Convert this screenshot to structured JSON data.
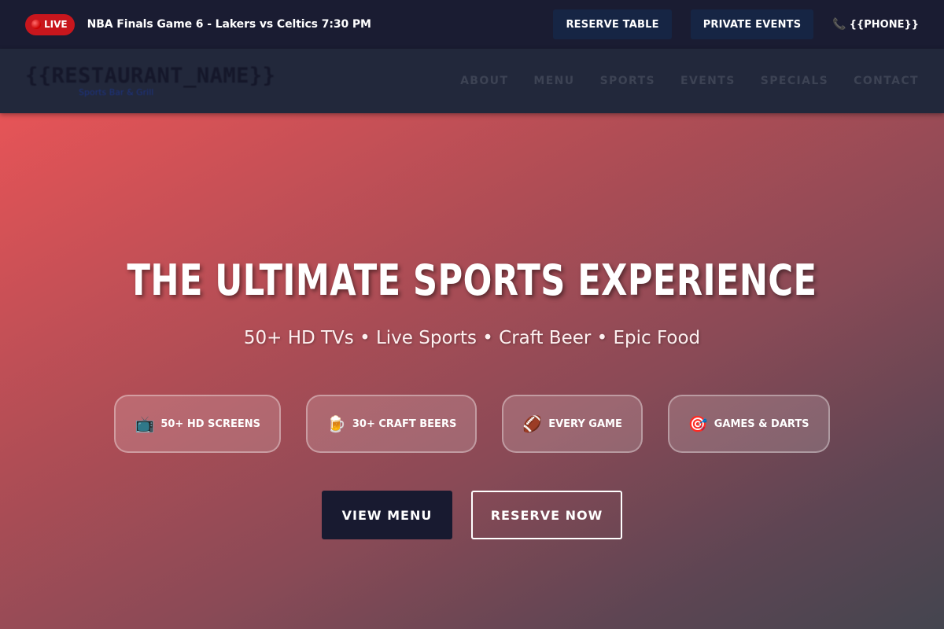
{
  "topbar": {
    "live_label": "LIVE",
    "ticker": "NBA Finals Game 6 - Lakers vs Celtics 7:30 PM",
    "reserve_table": "RESERVE TABLE",
    "private_events": "PRIVATE EVENTS",
    "phone_icon": "phone-icon",
    "phone": "{{PHONE}}"
  },
  "nav": {
    "logo_name": "{{RESTAURANT_NAME}}",
    "logo_tagline": "Sports Bar & Grill",
    "links": [
      "ABOUT",
      "MENU",
      "SPORTS",
      "EVENTS",
      "SPECIALS",
      "CONTACT"
    ]
  },
  "hero": {
    "title": "THE ULTIMATE SPORTS EXPERIENCE",
    "subtitle": "50+ HD TVs • Live Sports • Craft Beer • Epic Food",
    "features": [
      {
        "icon": "📺",
        "icon_name": "tv-icon",
        "label": "50+ HD SCREENS"
      },
      {
        "icon": "🍺",
        "icon_name": "beer-icon",
        "label": "30+ CRAFT BEERS"
      },
      {
        "icon": "🏈",
        "icon_name": "football-icon",
        "label": "EVERY GAME"
      },
      {
        "icon": "🎯",
        "icon_name": "dart-icon",
        "label": "GAMES & DARTS"
      }
    ],
    "cta_primary": "VIEW MENU",
    "cta_secondary": "RESERVE NOW"
  },
  "colors": {
    "topbar_bg": "#1a1c32",
    "live_red": "#c8161d",
    "button_navy": "#162544",
    "hero_gradient_start": "#e65457",
    "hero_gradient_end": "#44454f",
    "primary_btn": "#181a30"
  }
}
